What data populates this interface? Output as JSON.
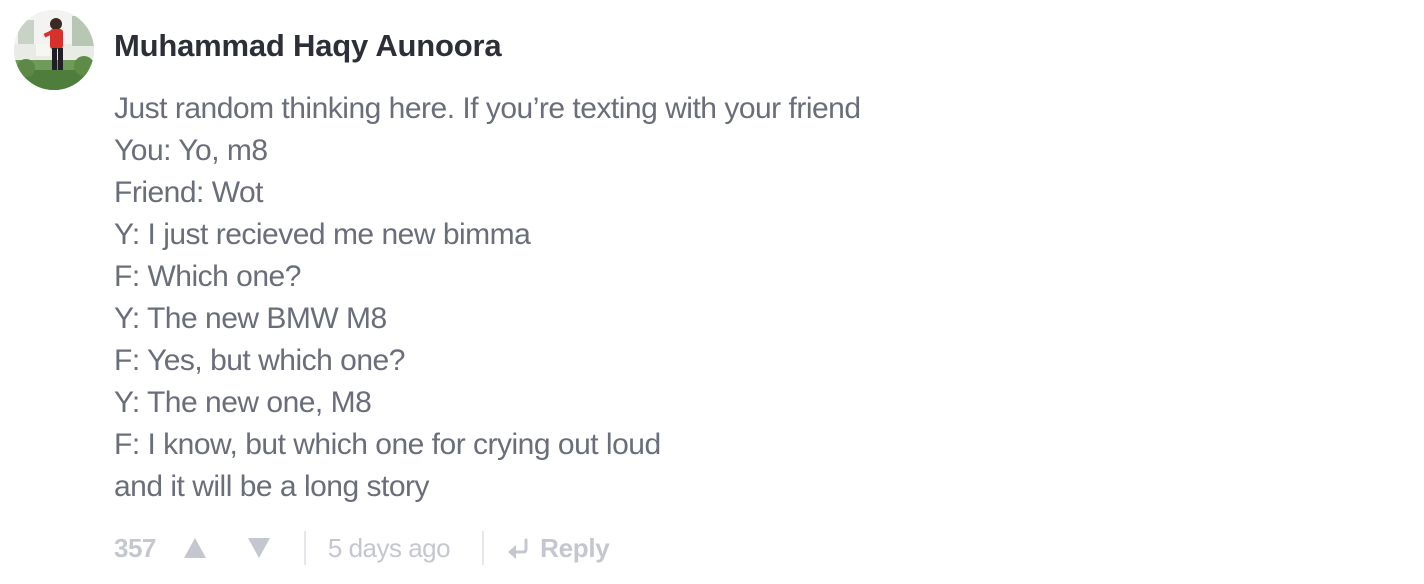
{
  "comment": {
    "author": "Muhammad Haqy Aunoora",
    "avatar_icon": "user-photo-avatar",
    "lines": [
      "Just random thinking here. If you’re texting with your friend",
      "You: Yo, m8",
      "Friend: Wot",
      "Y: I just recieved me new bimma",
      "F: Which one?",
      "Y: The new BMW M8",
      "F: Yes, but which one?",
      "Y: The new one, M8",
      "F: I know, but which one for crying out loud",
      "and it will be a long story"
    ],
    "score": "357",
    "timestamp": "5 days ago",
    "reply_label": "Reply",
    "upvote_icon": "triangle-up-icon",
    "downvote_icon": "triangle-down-icon",
    "reply_icon": "reply-arrow-icon"
  },
  "colors": {
    "author": "#2d2f38",
    "body_text": "#6a6d7a",
    "muted": "#c5c7d0",
    "separator": "#e6e7ec"
  }
}
